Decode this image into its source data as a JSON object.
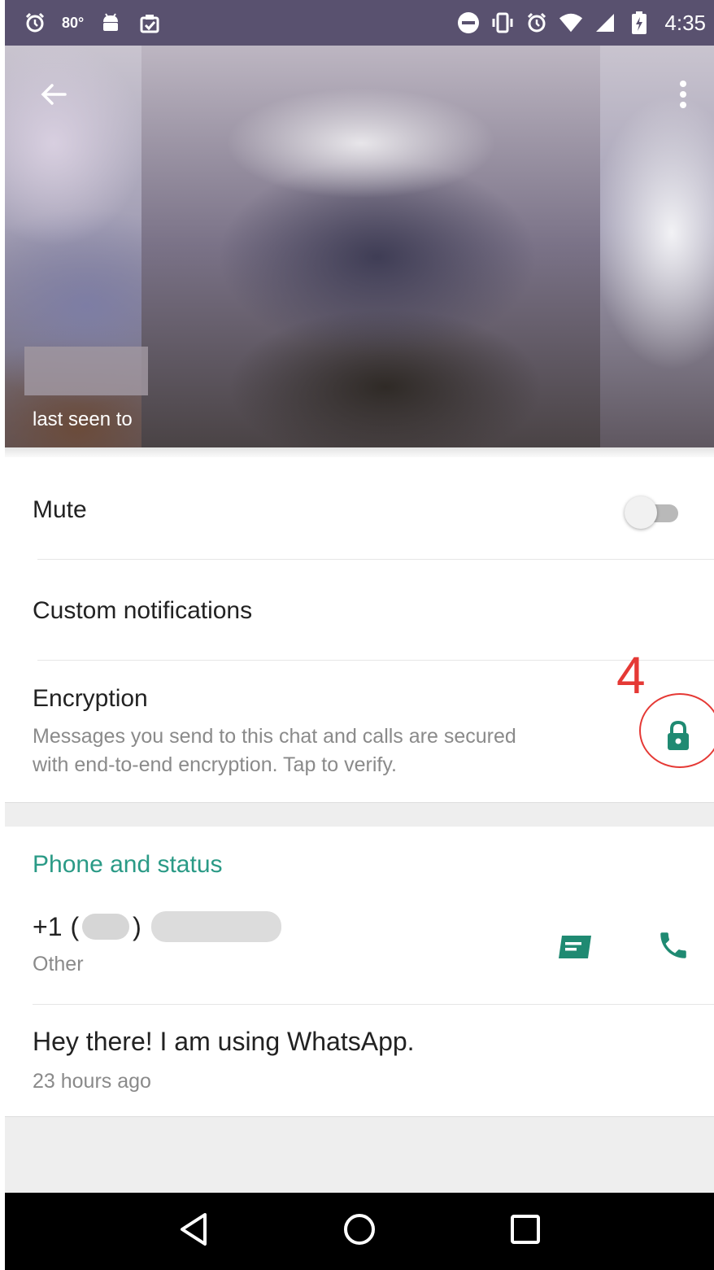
{
  "status_bar": {
    "temperature": "80°",
    "time": "4:35",
    "left_icons": [
      "alarm-icon",
      "android-icon",
      "clipboard-check-icon"
    ],
    "right_icons": [
      "do-not-disturb-icon",
      "vibrate-icon",
      "alarm-icon",
      "wifi-icon",
      "signal-icon",
      "battery-charging-icon"
    ]
  },
  "header": {
    "last_seen": "last seen to",
    "back_icon": "arrow-back-icon",
    "menu_icon": "more-vert-icon"
  },
  "settings": {
    "mute_label": "Mute",
    "mute_on": false,
    "custom_notifications_label": "Custom notifications",
    "encryption_label": "Encryption",
    "encryption_desc_line1": "Messages you send to this chat and calls are secured",
    "encryption_desc_line2": "with end-to-end encryption. Tap to verify.",
    "annotation": "4"
  },
  "phone_section": {
    "header": "Phone and status",
    "country_code": "+1",
    "paren_open": "(",
    "paren_close": ")",
    "phone_type": "Other",
    "status": "Hey there! I am using WhatsApp.",
    "status_time": "23 hours ago"
  },
  "colors": {
    "accent": "#2a9a86",
    "icon_teal": "#1f8a72",
    "status_bar": "#59516f",
    "annotation_red": "#e53935"
  },
  "nav": {
    "back": "nav-back-icon",
    "home": "nav-home-icon",
    "recents": "nav-recents-icon"
  }
}
